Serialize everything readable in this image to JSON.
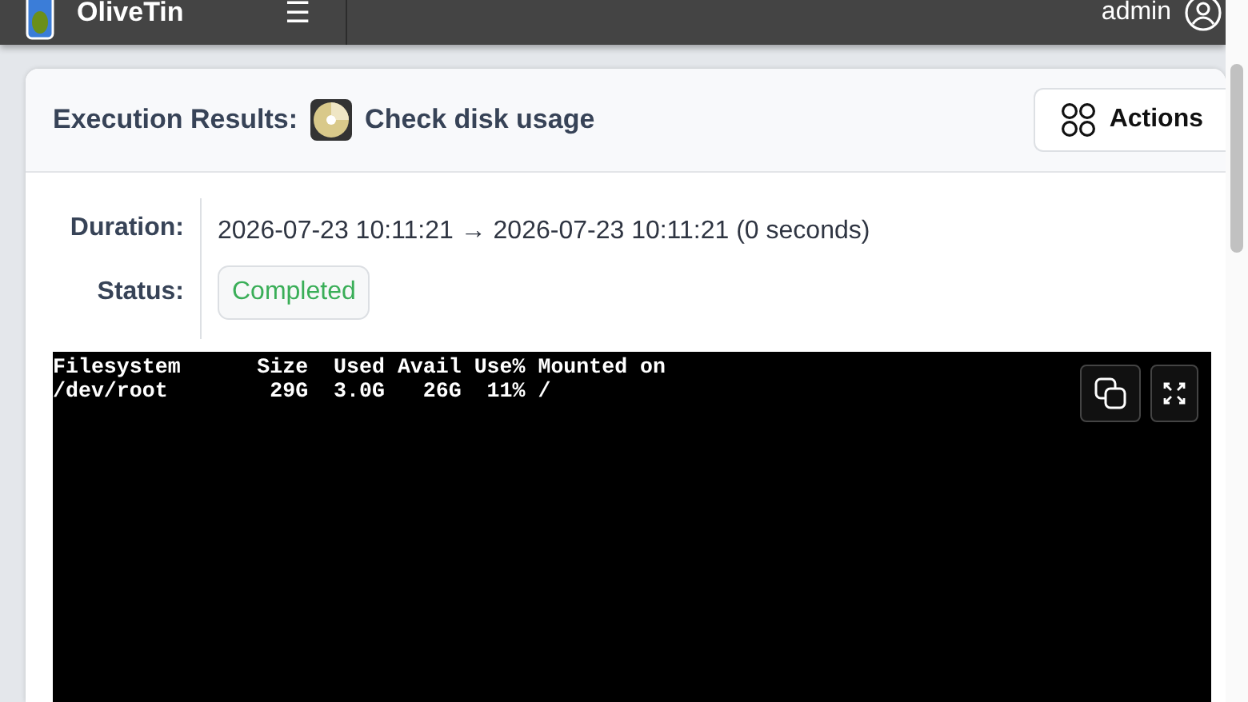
{
  "navbar": {
    "app_name": "OliveTin",
    "menu_glyph": "☰",
    "user": "admin"
  },
  "card": {
    "label": "Execution Results:",
    "action_title": "Check disk usage",
    "actions_button": "Actions"
  },
  "details": [
    {
      "label": "Duration:",
      "kind": "text",
      "value": "2026-07-23 10:11:21 → 2026-07-23 10:11:21 (0 seconds)"
    },
    {
      "label": "Status:",
      "kind": "badge",
      "value": "Completed"
    }
  ],
  "terminal": {
    "lines": [
      "Filesystem      Size  Used Avail Use% Mounted on",
      "/dev/root        29G  3.0G   26G  11% /"
    ]
  }
}
